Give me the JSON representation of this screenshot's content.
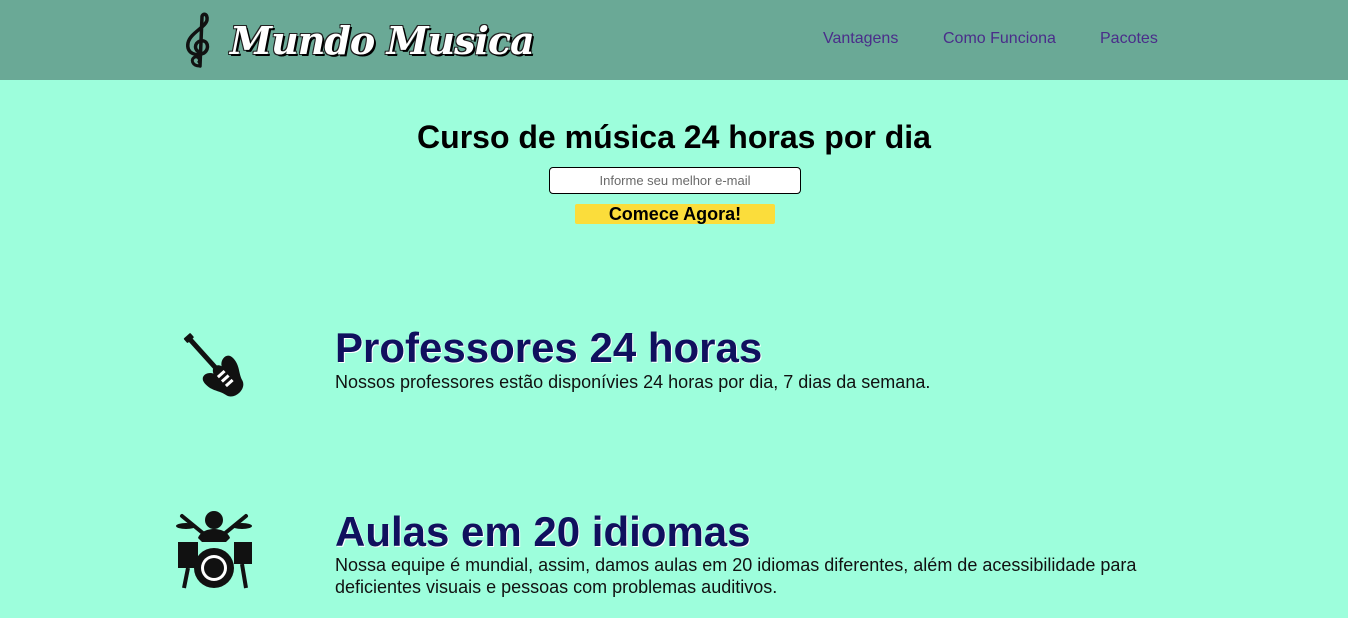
{
  "header": {
    "logo_text": "Mundo Musica",
    "nav": [
      {
        "label": "Vantagens"
      },
      {
        "label": "Como Funciona"
      },
      {
        "label": "Pacotes"
      }
    ]
  },
  "hero": {
    "title": "Curso de música 24 horas por dia",
    "email_placeholder": "Informe seu melhor e-mail",
    "cta_label": "Comece Agora!"
  },
  "features": [
    {
      "icon": "electric-guitar-icon",
      "title": "Professores 24 horas",
      "text": "Nossos professores estão disponívies 24 horas por dia, 7 dias da semana."
    },
    {
      "icon": "drummer-icon",
      "title": "Aulas em 20 idiomas",
      "text": "Nossa equipe é mundial, assim, damos aulas em 20 idiomas diferentes, além de acessibilidade para deficientes visuais e pessoas com problemas auditivos."
    }
  ],
  "colors": {
    "header_bg": "#6aa996",
    "page_bg": "#9dfedc",
    "nav_link": "#4a2d8a",
    "cta_bg": "#fbdd3b",
    "feature_title": "#10105e"
  }
}
